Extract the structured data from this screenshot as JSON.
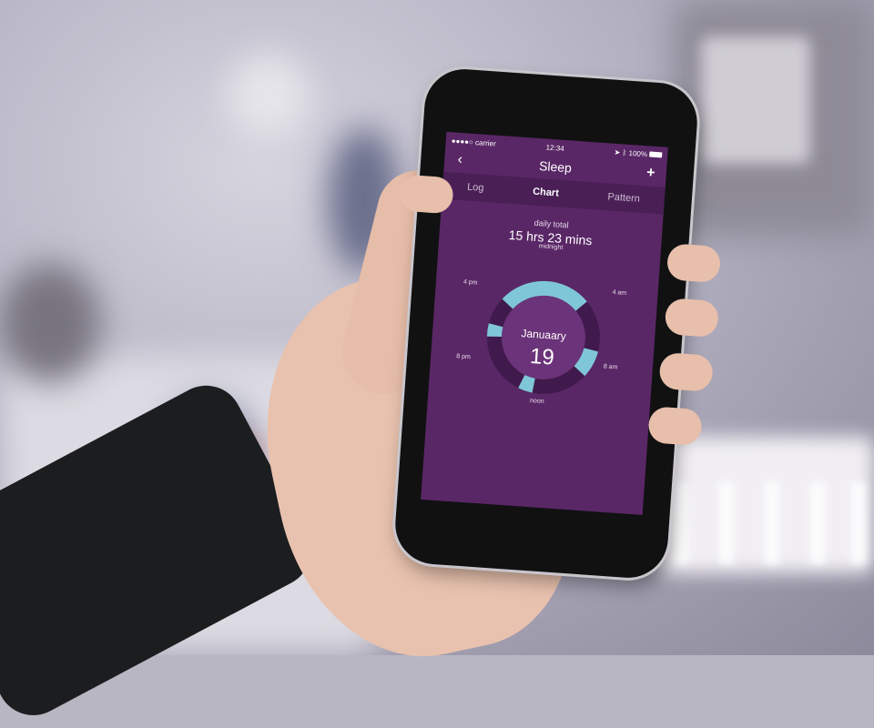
{
  "status_bar": {
    "carrier": "●●●●○ carrier",
    "time": "12:34",
    "battery": "100%"
  },
  "nav": {
    "back_icon": "chevron-left-icon",
    "title": "Sleep",
    "add_icon": "plus-icon"
  },
  "tabs": [
    {
      "label": "Log"
    },
    {
      "label": "Chart"
    },
    {
      "label": "Pattern"
    }
  ],
  "summary": {
    "label": "daily total",
    "value": "15 hrs 23 mins"
  },
  "clock_labels": {
    "midnight": "midnight",
    "four_am": "4 am",
    "eight_am": "8 am",
    "noon": "noon",
    "eight_pm": "8 pm",
    "four_pm": "4 pm"
  },
  "date": {
    "month": "Januaary",
    "day": "19"
  },
  "colors": {
    "background": "#5a2766",
    "tab_bar": "#4a1f56",
    "ring_outer": "#401a4c",
    "ring_inner": "#6b3379",
    "sleep": "#7fc7d8"
  },
  "sleep_segments_hours": [
    {
      "start": 20.6,
      "end": 3.1
    },
    {
      "start": 6.7,
      "end": 8.6
    },
    {
      "start": 12.5,
      "end": 13.3
    },
    {
      "start": 13.0,
      "end": 13.5
    },
    {
      "start": 17.8,
      "end": 18.7
    }
  ]
}
